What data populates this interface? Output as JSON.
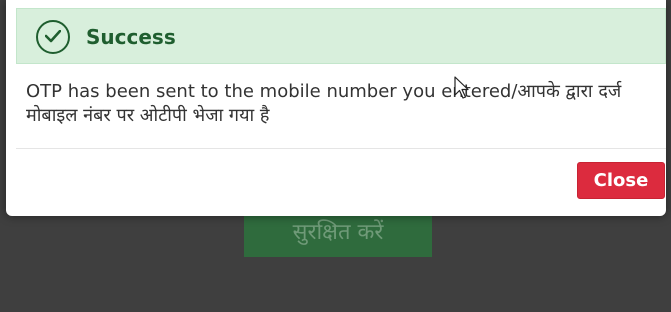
{
  "background": {
    "save_button_label": "सुरक्षित करें"
  },
  "dialog": {
    "title": "Success",
    "message": "OTP has been sent to the mobile number you entered/आपके द्वारा दर्ज मोबाइल नंबर पर ओटीपी भेजा गया है",
    "close_label": "Close",
    "icon": "check-circle-icon"
  },
  "colors": {
    "header_bg": "#d8efdc",
    "success_text": "#1f5e2f",
    "close_button": "#dc2b3e",
    "backdrop": "#3f3f3f",
    "backdrop_button": "#2f6b3d"
  }
}
